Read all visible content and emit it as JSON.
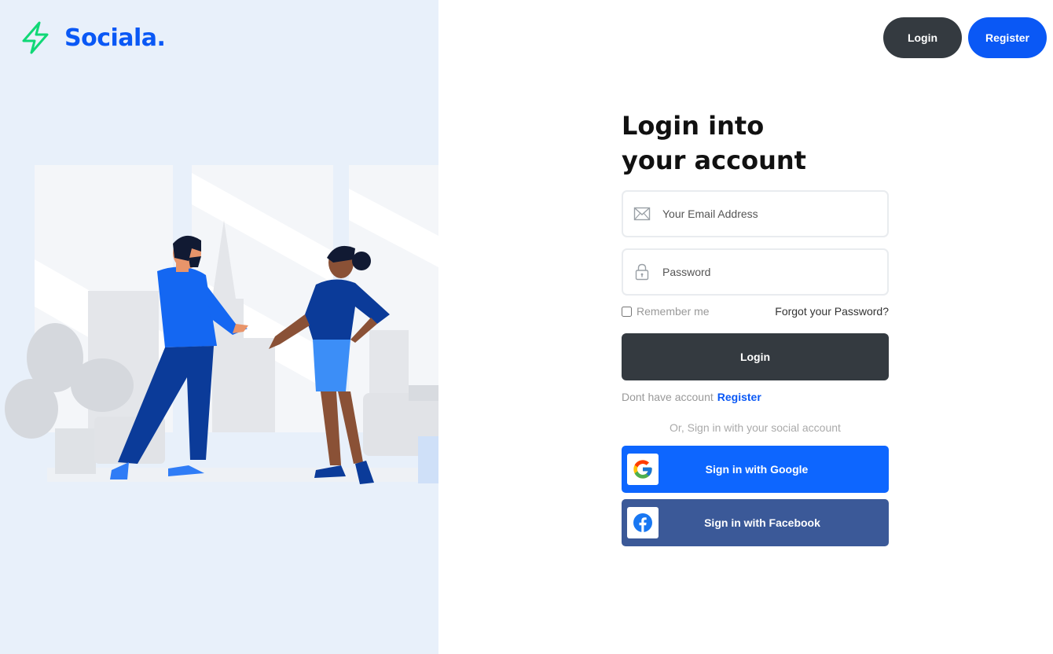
{
  "brand": {
    "name": "Sociala.",
    "color": "#0a58f5",
    "icon": "lightning-bolt-icon",
    "icon_color": "#10d876"
  },
  "nav": {
    "login_label": "Login",
    "register_label": "Register"
  },
  "form": {
    "title_line1": "Login into",
    "title_line2": "your account",
    "email": {
      "placeholder": "Your Email Address",
      "value": "",
      "icon": "envelope-icon"
    },
    "password": {
      "placeholder": "Password",
      "value": "",
      "icon": "lock-icon"
    },
    "remember_label": "Remember me",
    "remember_checked": false,
    "forgot_label": "Forgot your Password?",
    "submit_label": "Login",
    "no_account_text": "Dont have account",
    "register_link": "Register",
    "social_caption": "Or, Sign in with your social account",
    "google_label": "Sign in with Google",
    "facebook_label": "Sign in with Facebook"
  },
  "colors": {
    "dark_button": "#343a40",
    "primary": "#0a58f5",
    "google_button": "#0d66ff",
    "facebook_button": "#3b5998",
    "left_panel_bg": "#e8f0fa"
  }
}
